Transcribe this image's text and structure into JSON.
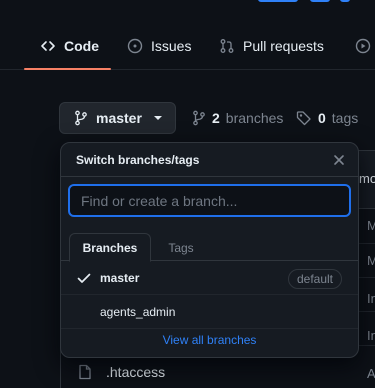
{
  "tabs": [
    {
      "label": "Code",
      "icon": "code-icon",
      "active": true
    },
    {
      "label": "Issues",
      "icon": "issue-icon",
      "active": false
    },
    {
      "label": "Pull requests",
      "icon": "pull-request-icon",
      "active": false
    }
  ],
  "branch_bar": {
    "current_branch": "master",
    "branches_count": "2",
    "branches_word": "branches",
    "tags_count": "0",
    "tags_word": "tags"
  },
  "dropdown": {
    "title": "Switch branches/tags",
    "search_placeholder": "Find or create a branch...",
    "tabs": [
      "Branches",
      "Tags"
    ],
    "items": [
      {
        "name": "master",
        "selected": true,
        "badge": "default"
      },
      {
        "name": "agents_admin",
        "selected": false
      }
    ],
    "view_all": "View all branches"
  },
  "background_table": {
    "partial_cells": [
      "mo",
      "M",
      "M",
      "In",
      "In",
      "In",
      "A"
    ],
    "file_name": ".htaccess"
  },
  "colors": {
    "background": "#0d1117",
    "accent": "#2f81f7",
    "tab_underline": "#f78166",
    "border": "#30363d"
  }
}
